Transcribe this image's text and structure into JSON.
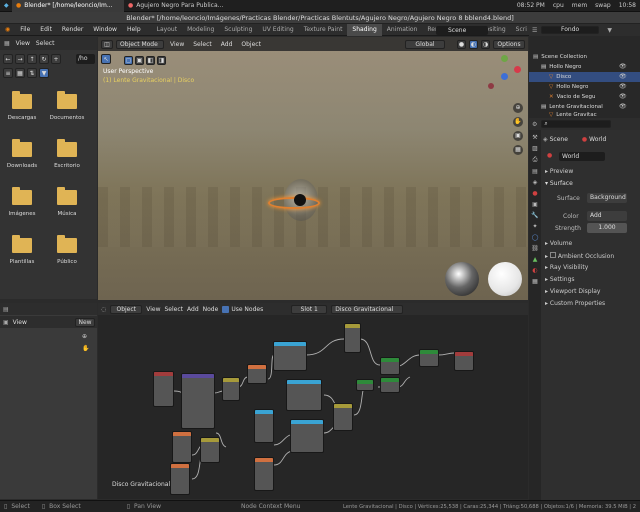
{
  "taskbar": {
    "items": [
      "Blender* [/home/leoncio/Im...",
      "Agujero Negro Para Publica..."
    ],
    "clock": "08:52 PM",
    "cpu": "cpu",
    "mem": "mem",
    "swap": "swap",
    "time2": "10:58"
  },
  "window_title": "Blender* [/home/leoncio/Imágenes/Practicas Blender/Practicas Blentuts/Agujero Negro/Agujero Negro 8 bblend4.blend]",
  "menu": [
    "File",
    "Edit",
    "Render",
    "Window",
    "Help"
  ],
  "workspaces": [
    "Layout",
    "Modeling",
    "Sculpting",
    "UV Editing",
    "Texture Paint",
    "Shading",
    "Animation",
    "Rendering",
    "Compositing",
    "Scri"
  ],
  "active_workspace": "Shading",
  "scene_label": "Scene",
  "viewlayer_label": "Fondo",
  "file_browser": {
    "menu": [
      "View",
      "Select"
    ],
    "path": "/ho",
    "folders": [
      "Descargas",
      "Documentos",
      "Downloads",
      "Escritorio",
      "Imágenes",
      "Música",
      "Plantillas",
      "Público"
    ]
  },
  "viewport": {
    "mode": "Object Mode",
    "menu": [
      "View",
      "Select",
      "Add",
      "Object"
    ],
    "transform": "Global",
    "options": "Options",
    "overlay_title": "User Perspective",
    "overlay_sub": "(1) Lente Gravitacional | Disco"
  },
  "image_editor": {
    "view": "View",
    "new_label": "New"
  },
  "node_editor": {
    "editor": "Object",
    "menu": [
      "View",
      "Select",
      "Add",
      "Node"
    ],
    "use_nodes": "Use Nodes",
    "slot": "Slot 1",
    "material": "Disco Gravitacional",
    "corner_label": "Disco Gravitacional"
  },
  "outliner": {
    "title": "Scene Collection",
    "items": [
      {
        "label": "Hollo Negro",
        "indent": 1
      },
      {
        "label": "Disco",
        "indent": 2,
        "selected": true
      },
      {
        "label": "Hollo Negro",
        "indent": 2
      },
      {
        "label": "Vacio de  Segu",
        "indent": 2
      },
      {
        "label": "Lente Gravitacional",
        "indent": 1
      },
      {
        "label": "Lente Gravitac",
        "indent": 2
      }
    ]
  },
  "properties": {
    "scene_tab": "Scene",
    "world_tab": "World",
    "world_name": "World",
    "panels_closed_1": [
      "Preview"
    ],
    "surface_panel": "Surface",
    "surface_label": "Surface",
    "surface_value": "Background",
    "color_label": "Color",
    "color_value": "Add",
    "strength_label": "Strength",
    "strength_value": "1.000",
    "panels_closed_2": [
      "Volume",
      "Ambient Occlusion",
      "Ray Visibility",
      "Settings",
      "Viewport Display",
      "Custom Properties"
    ]
  },
  "status": {
    "left": [
      "Select",
      "Box Select",
      "Pan View",
      "Node Context Menu"
    ],
    "right": "Lente Gravitacional | Disco | Vértices:25,538 | Caras:25,344 | Triáng:50,688 | Objetos:1/6 | Memoria: 39.5 MiB | 2"
  },
  "colors": {
    "accent": "#4772b3",
    "folder": "#e0b455",
    "ring": "#e08030"
  }
}
